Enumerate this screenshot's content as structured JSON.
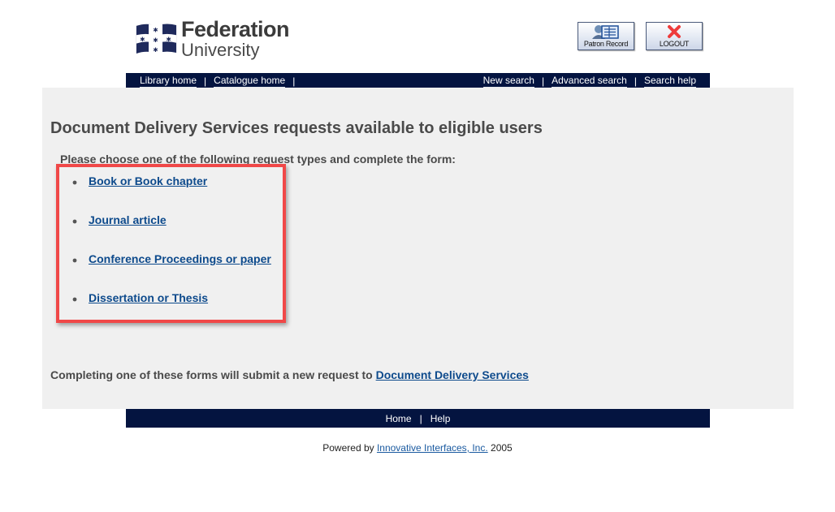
{
  "header": {
    "logo": {
      "line1": "Federation",
      "line2": "University",
      "icon": "southern-cross-flag-icon"
    },
    "buttons": [
      {
        "label": "Patron Record",
        "icon": "patron-record-icon"
      },
      {
        "label": "LOGOUT",
        "icon": "logout-x-icon"
      }
    ]
  },
  "topnav": {
    "left": [
      "Library home",
      "Catalogue home"
    ],
    "right": [
      "New search",
      "Advanced search",
      "Search help"
    ],
    "separator": "|"
  },
  "main": {
    "title": "Document Delivery Services requests available to eligible users",
    "instructions": "Please choose one of the following request types and complete the form:",
    "request_types": [
      "Book or Book chapter",
      "Journal article",
      "Conference Proceedings or paper",
      "Dissertation or Thesis"
    ],
    "note_prefix": "Completing one of these forms will submit a new request to ",
    "note_link": "Document Delivery Services"
  },
  "bottomnav": {
    "items": [
      "Home",
      "Help"
    ],
    "separator": "|"
  },
  "footer": {
    "prefix": "Powered by ",
    "link": "Innovative Interfaces, Inc.",
    "suffix": " 2005"
  },
  "colors": {
    "nav_bg": "#041440",
    "panel_bg": "#f0f0f0",
    "link": "#0d4a8c",
    "highlight": "#f04848",
    "text": "#4a4a4a"
  }
}
